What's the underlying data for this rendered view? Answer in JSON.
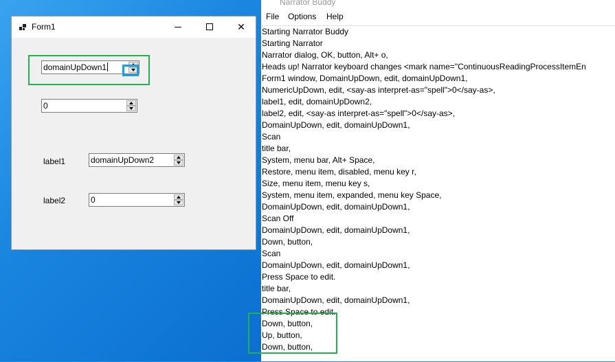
{
  "form1": {
    "title": "Form1",
    "domain_up_down_1": "domainUpDown1",
    "numeric_up_down": "0",
    "label1": "label1",
    "domain_up_down_2": "domainUpDown2",
    "label2": "label2",
    "label2_value": "0"
  },
  "narrator": {
    "title": "Narrator Buddy",
    "menu": [
      "File",
      "Options",
      "Help"
    ],
    "log": [
      "Starting Narrator Buddy",
      "Starting Narrator",
      "Narrator dialog, OK, button, Alt+ o,",
      "Heads up! Narrator keyboard changes <mark name=\"ContinuousReadingProcessItemEn",
      "Form1 window, DomainUpDown, edit, domainUpDown1,",
      "NumericUpDown, edit, <say-as interpret-as=\"spell\">0</say-as>,",
      "label1, edit, domainUpDown2,",
      "label2, edit, <say-as interpret-as=\"spell\">0</say-as>,",
      "DomainUpDown, edit, domainUpDown1,",
      "Scan",
      "title bar,",
      "System, menu bar, Alt+ Space,",
      "Restore, menu item, disabled, menu key r,",
      "Size, menu item, menu key s,",
      "System, menu item, expanded, menu key Space,",
      "DomainUpDown, edit, domainUpDown1,",
      "Scan Off",
      "DomainUpDown, edit, domainUpDown1,",
      "Down, button,",
      "Scan",
      "DomainUpDown, edit, domainUpDown1,",
      "Press Space to edit.",
      "title bar,",
      "DomainUpDown, edit, domainUpDown1,",
      "Press Space to edit.",
      "Down, button,",
      "Up, button,",
      "Down, button,"
    ]
  }
}
